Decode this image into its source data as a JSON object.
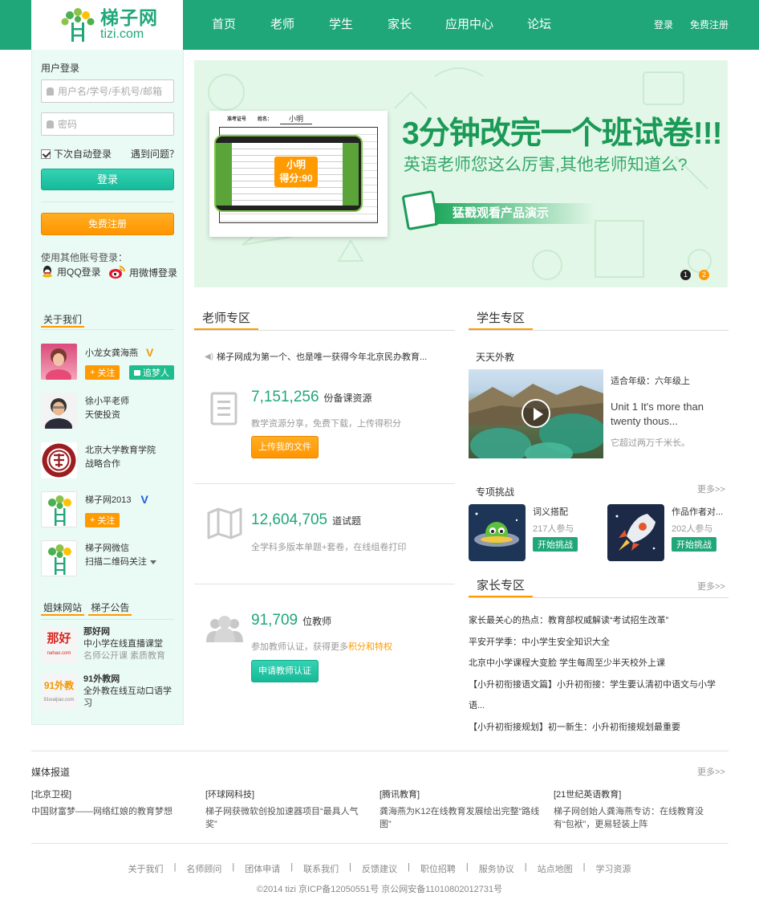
{
  "header": {
    "logo_cn": "梯子网",
    "logo_en": "tizi.com",
    "nav": [
      "首页",
      "老师",
      "学生",
      "家长",
      "应用中心",
      "论坛"
    ],
    "login": "登录",
    "register": "免费注册"
  },
  "login_box": {
    "title": "用户登录",
    "username_placeholder": "用户名/学号/手机号/邮箱",
    "password_placeholder": "密码",
    "remember": "下次自动登录",
    "problem": "遇到问题？",
    "login_button": "登录",
    "register_button": "免费注册",
    "other_login": "使用其他账号登录：",
    "qq": "用QQ登录",
    "weibo": "用微博登录"
  },
  "about": {
    "title": "关于我们",
    "people": [
      {
        "name": "小龙女龚海燕",
        "badge": "V",
        "follow": "关注",
        "extra": "追梦人"
      },
      {
        "name": "徐小平老师",
        "desc": "天使投资"
      },
      {
        "name": "北京大学教育学院",
        "desc": "战略合作"
      },
      {
        "name": "梯子网2013",
        "badge": "V",
        "follow": "关注"
      },
      {
        "name": "梯子网微信",
        "desc": "扫描二维码关注"
      }
    ]
  },
  "sister": {
    "tab1": "姐妹网站",
    "tab2": "梯子公告",
    "sites": [
      {
        "logo": "那好",
        "logo_sub": "nahao.com",
        "name": "那好网",
        "desc": "中小学在线直播课堂",
        "desc2": "名师公开课  素质教育"
      },
      {
        "logo": "91外教",
        "logo_sub": "91waijiao.com",
        "name": "91外教网",
        "desc": "全外教在线互动口语学习"
      }
    ]
  },
  "banner": {
    "headline": "3分钟改完一个班试卷!!!",
    "sub": "英语老师您这么厉害,其他老师知道么?",
    "cta": "猛戳观看产品演示",
    "paper_name": "小明",
    "paper_score": "小明\n得分:90",
    "paper_header1": "准考证号",
    "paper_header2": "姓名：",
    "dots": [
      "1",
      "2"
    ]
  },
  "teacher": {
    "title": "老师专区",
    "notice": "梯子网成为第一个、也是唯一获得今年北京民办教育...",
    "stats": [
      {
        "num": "7,151,256",
        "unit": "份备课资源",
        "desc": "教学资源分享，免费下载，上传得积分",
        "button": "上传我的文件"
      },
      {
        "num": "12,604,705",
        "unit": "道试题",
        "desc": "全学科多版本单题+套卷，在线组卷打印"
      },
      {
        "num": "91,709",
        "unit": "位教师",
        "desc": "参加教师认证，获得更多",
        "desc_link": "积分和特权",
        "button": "申请教师认证"
      }
    ]
  },
  "student": {
    "title": "学生专区",
    "daily_title": "天天外教",
    "grade": "适合年级：六年级上",
    "lesson": "Unit 1 It's more than twenty thous...",
    "lesson_desc": "它超过两万千米长。",
    "challenge_title": "专项挑战",
    "more": "更多>>",
    "challenges": [
      {
        "name": "词义搭配",
        "count": "217人参与",
        "button": "开始挑战"
      },
      {
        "name": "作品作者对...",
        "count": "202人参与",
        "button": "开始挑战"
      }
    ]
  },
  "parent": {
    "title": "家长专区",
    "more": "更多>>",
    "news": [
      "家长最关心的热点：教育部权威解读“考试招生改革”",
      "平安开学季：中小学生安全知识大全",
      "北京中小学课程大变脸 学生每周至少半天校外上课",
      "【小升初衔接语文篇】小升初衔接：学生要认清初中语文与小学语...",
      "【小升初衔接规划】初一新生：小升初衔接规划最重要"
    ]
  },
  "media": {
    "title": "媒体报道",
    "more": "更多>>",
    "items": [
      {
        "source": "[北京卫视]",
        "title": "中国财富梦——网络红娘的教育梦想"
      },
      {
        "source": "[环球网科技]",
        "title": "梯子网获微软创投加速器项目“最具人气奖”"
      },
      {
        "source": "[腾讯教育]",
        "title": "龚海燕为K12在线教育发展绘出完整“路线图”"
      },
      {
        "source": "[21世纪英语教育]",
        "title": "梯子网创始人龚海燕专访：在线教育没有“包袱”，更易轻装上阵"
      }
    ]
  },
  "footer": {
    "links": [
      "关于我们",
      "名师顾问",
      "团体申请",
      "联系我们",
      "反馈建议",
      "职位招聘",
      "服务协议",
      "站点地图",
      "学习资源"
    ],
    "copyright": "©2014 tizi 京ICP备12050551号 京公网安备11010802012731号"
  },
  "colors": {
    "brand": "#1fa77a",
    "accent": "#ff9a00",
    "banner_bg": "#e3f7e8"
  }
}
